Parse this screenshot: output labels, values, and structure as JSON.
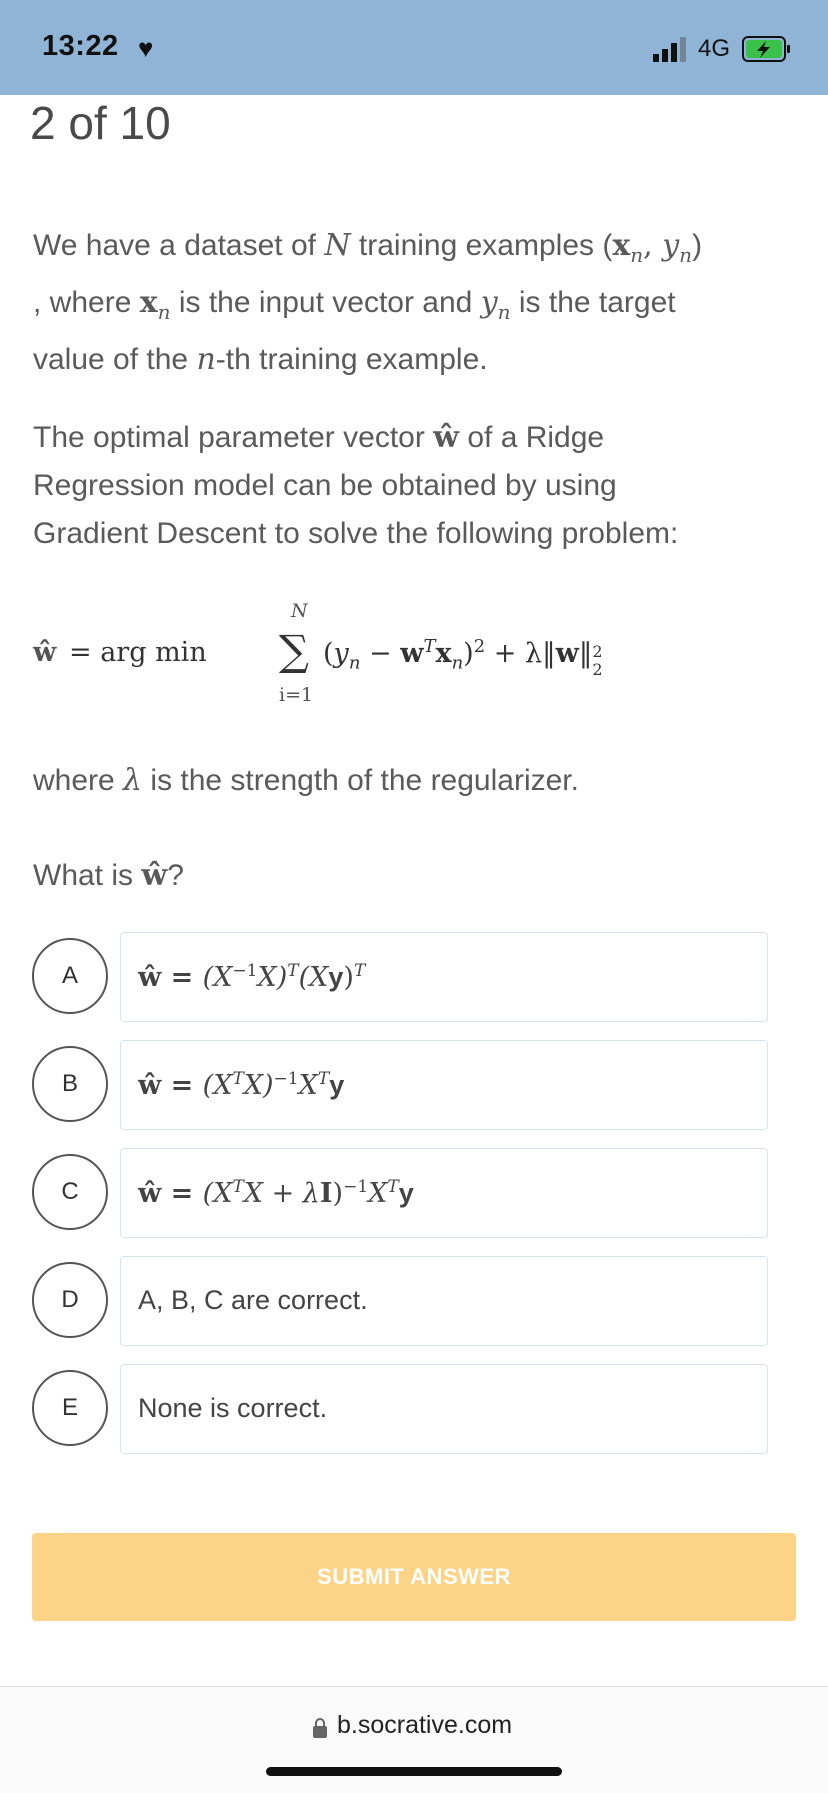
{
  "status_bar": {
    "time": "13:22",
    "network": "4G"
  },
  "quiz": {
    "progress": "2 of 10"
  },
  "question": {
    "p1": {
      "a": "We have a dataset of ",
      "N": "N",
      "b": " training examples (",
      "x": "x",
      "sub_n": "n",
      "comma": ", ",
      "y": "y",
      "c": ")",
      "d": ", where ",
      "e": " is the input vector and ",
      "f": " is the target",
      "g": "value of the ",
      "h": "-th training example."
    },
    "p2": {
      "a": "The optimal parameter vector ",
      "w": "w",
      "hat": "^",
      "b": " of a Ridge",
      "c": "Regression model can be obtained by using",
      "d": "Gradient Descent to solve the following  problem:"
    },
    "formula": {
      "argmin": "= arg min",
      "sum_top": "N",
      "sum_sym": "∑",
      "sum_bot": "i=1",
      "lhs_hat": "ŵ",
      "open": "(",
      "minus": " − ",
      "T": "T",
      "sq": "2",
      "plus_lambda": " + λ‖",
      "norm_close": "‖",
      "norm_sub": "2",
      "norm_sup": "2"
    },
    "p3": {
      "a": "where ",
      "lambda": "λ",
      "b": " is the strength of the regularizer."
    },
    "p4": {
      "a": "What is ",
      "b": "?"
    }
  },
  "options": [
    {
      "letter": "A",
      "math": {
        "lhs": "ŵ = ",
        "pre": "(X",
        "sup1": "−1",
        "mid": "X)",
        "sup2": "T",
        "mid2": "(X",
        "y": "y",
        "close": ")",
        "sup3": "T"
      }
    },
    {
      "letter": "B",
      "math": {
        "lhs": "ŵ = ",
        "pre": "(X",
        "sup1": "T",
        "mid": "X)",
        "sup2": "−1",
        "mid2": "X",
        "sup3": "T",
        "y": "y"
      }
    },
    {
      "letter": "C",
      "math": {
        "lhs": "ŵ = ",
        "pre": "(X",
        "sup1": "T",
        "mid": "X + λ",
        "I": "I",
        "close": ")",
        "sup2": "−1",
        "mid2": "X",
        "sup3": "T",
        "y": "y"
      }
    },
    {
      "letter": "D",
      "text": "A, B, C are correct."
    },
    {
      "letter": "E",
      "text": "None is correct."
    }
  ],
  "submit": {
    "label": "SUBMIT ANSWER",
    "color": "#fdd487"
  },
  "browser": {
    "url": "b.socrative.com"
  }
}
